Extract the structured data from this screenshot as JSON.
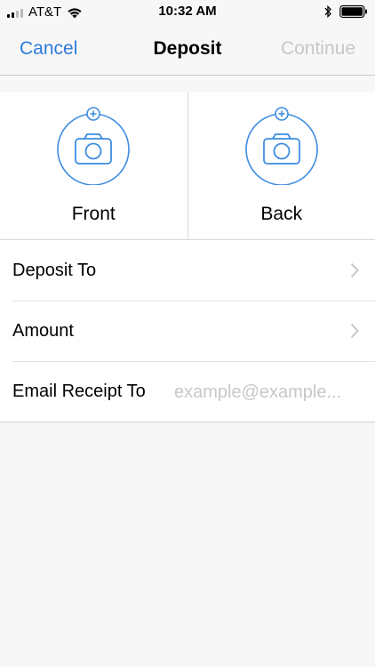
{
  "status_bar": {
    "carrier": "AT&T",
    "time": "10:32 AM"
  },
  "nav": {
    "cancel_label": "Cancel",
    "title": "Deposit",
    "continue_label": "Continue"
  },
  "capture": {
    "front_label": "Front",
    "back_label": "Back"
  },
  "form": {
    "deposit_to_label": "Deposit To",
    "amount_label": "Amount",
    "email_label": "Email Receipt To",
    "email_value": "",
    "email_placeholder": "example@example..."
  },
  "colors": {
    "accent": "#2d7bd8",
    "disabled": "#c7c7cc",
    "icon_blue": "#3d8ce0"
  },
  "icons": [
    "signal-icon",
    "wifi-icon",
    "bluetooth-icon",
    "battery-icon",
    "camera-icon",
    "plus-icon",
    "chevron-right-icon"
  ]
}
